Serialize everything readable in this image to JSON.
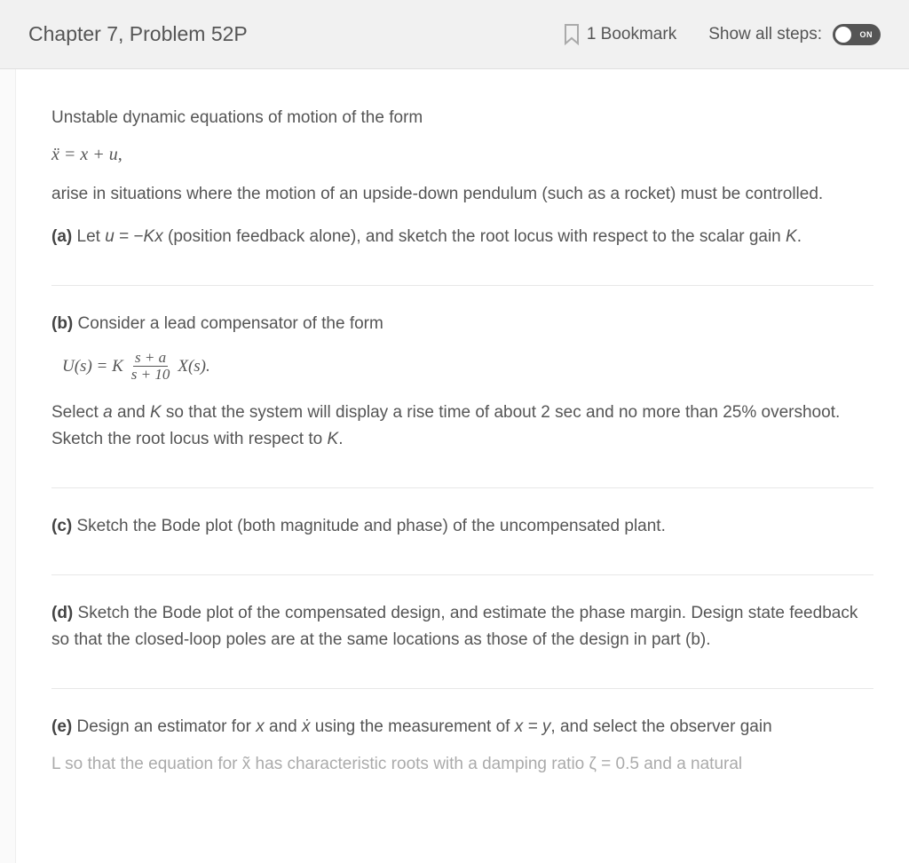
{
  "header": {
    "title": "Chapter 7, Problem 52P",
    "bookmark_label": "1 Bookmark",
    "steps_label": "Show all steps:",
    "toggle_state": "ON"
  },
  "problem": {
    "intro1": "Unstable dynamic equations of motion of the form",
    "equation1": "ẍ = x + u,",
    "intro2": "arise in situations where the motion of an upside-down pendulum (such as a rocket) must be controlled.",
    "parts": {
      "a": {
        "label": "(a)",
        "text_before": " Let ",
        "var_u": "u",
        "eq_mid": " = −",
        "var_Kx": "Kx",
        "text_after": " (position feedback alone), and sketch the root locus with respect to the scalar gain ",
        "var_K": "K",
        "text_end": "."
      },
      "b": {
        "label": "(b)",
        "lead": " Consider a lead compensator of the form",
        "eq_lhs": "U(s) = K",
        "frac_num": "s + a",
        "frac_den": "s + 10",
        "eq_rhs": "X(s).",
        "tail1": "Select ",
        "var_a": "a",
        "tail2": " and ",
        "var_K": "K",
        "tail3": " so that the system will display a rise time of about 2 sec and no more than 25% overshoot. Sketch the root locus with respect to ",
        "var_K2": "K",
        "tail4": "."
      },
      "c": {
        "label": "(c)",
        "text": " Sketch the Bode plot (both magnitude and phase) of the uncompensated plant."
      },
      "d": {
        "label": "(d)",
        "text": " Sketch the Bode plot of the compensated design, and estimate the phase margin. Design state feedback so that the closed-loop poles are at the same locations as those of the design in part (b)."
      },
      "e": {
        "label": "(e)",
        "text_before": " Design an estimator for ",
        "var_x": "x",
        "text_and": " and ",
        "var_xdot": "ẋ",
        "text_mid": " using the measurement of ",
        "var_xy": "x = y",
        "text_after": ", and select the observer gain",
        "cutoff": "L so that the equation for x̃ has characteristic roots with a damping ratio ζ = 0.5 and a natural"
      }
    }
  }
}
